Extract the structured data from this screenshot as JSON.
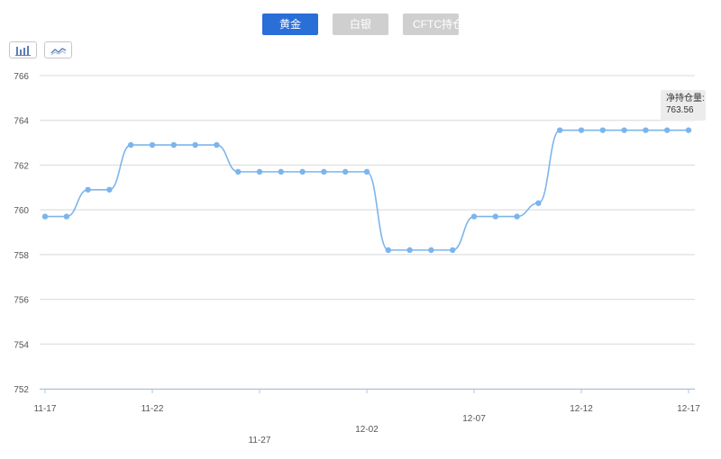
{
  "tabs": [
    {
      "label": "黄金ETF",
      "active": true
    },
    {
      "label": "白银ETF",
      "active": false
    },
    {
      "label": "CFTC持仓",
      "active": false
    }
  ],
  "toggles": {
    "bar": {
      "icon": "bar-chart-icon"
    },
    "line": {
      "icon": "line-chart-icon"
    }
  },
  "colors": {
    "active_tab": "#2a6ed8",
    "inactive_tab": "#cfcfcf",
    "series": "#7cb5ec",
    "grid": "#d8d8d8"
  },
  "tooltip": {
    "label": "净持仓量:",
    "value": "763.56"
  },
  "chart_data": {
    "type": "line",
    "x": [
      "11-17",
      "11-18",
      "11-19",
      "11-20",
      "11-21",
      "11-22",
      "11-23",
      "11-24",
      "11-25",
      "11-26",
      "11-27",
      "11-28",
      "11-29",
      "11-30",
      "12-01",
      "12-02",
      "12-03",
      "12-04",
      "12-05",
      "12-06",
      "12-07",
      "12-08",
      "12-09",
      "12-10",
      "12-11",
      "12-12",
      "12-13",
      "12-14",
      "12-15",
      "12-16",
      "12-17"
    ],
    "series": [
      {
        "name": "净持仓量",
        "values": [
          759.7,
          759.7,
          760.9,
          760.9,
          762.9,
          762.9,
          762.9,
          762.9,
          762.9,
          761.7,
          761.7,
          761.7,
          761.7,
          761.7,
          761.7,
          761.7,
          758.2,
          758.2,
          758.2,
          758.2,
          759.7,
          759.7,
          759.7,
          760.3,
          763.56,
          763.56,
          763.56,
          763.56,
          763.56,
          763.56,
          763.56
        ]
      }
    ],
    "xticks": [
      "11-17",
      "11-22",
      "11-27",
      "12-02",
      "12-07",
      "12-12",
      "12-17"
    ],
    "yticks": [
      "752",
      "754",
      "756",
      "758",
      "760",
      "762",
      "764",
      "766"
    ],
    "ylim": [
      752,
      766
    ],
    "grid": true
  }
}
